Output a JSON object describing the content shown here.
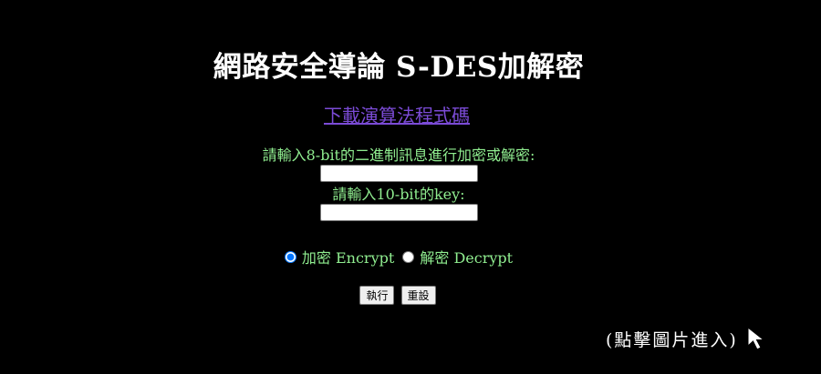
{
  "header": {
    "title": "網路安全導論 S-DES加解密"
  },
  "download": {
    "link_text": "下載演算法程式碼"
  },
  "form": {
    "message_label": "請輸入8-bit的二進制訊息進行加密或解密:",
    "message_value": "",
    "key_label": "請輸入10-bit的key:",
    "key_value": "",
    "mode": {
      "selected": "encrypt",
      "encrypt_label": "加密 Encrypt",
      "decrypt_label": "解密 Decrypt"
    },
    "submit_label": "執行",
    "reset_label": "重設"
  },
  "enter": {
    "hint_text": "(點擊圖片進入)",
    "icon": "cursor-arrow-icon"
  },
  "colors": {
    "background": "#000000",
    "title": "#ffffff",
    "label_text": "#90ee90",
    "link": "#7b4bd6"
  }
}
